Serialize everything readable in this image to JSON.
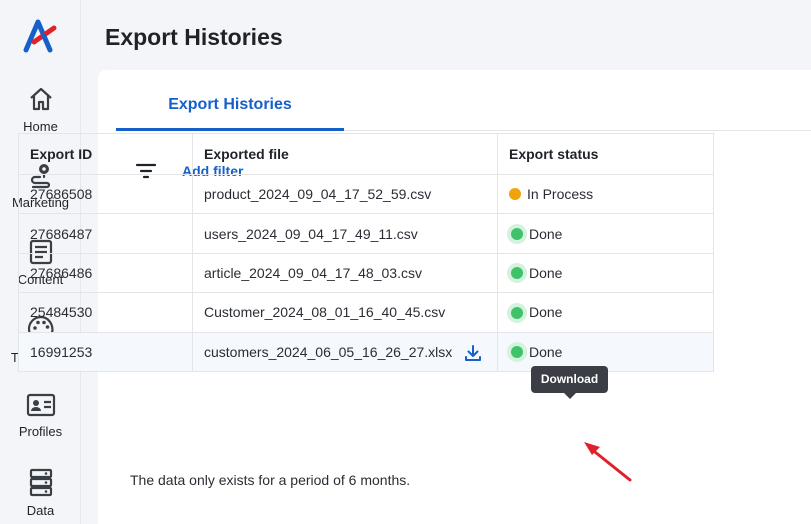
{
  "colors": {
    "accent": "#1560c9",
    "in_process": "#f0a30a",
    "done": "#3fc26a",
    "arrow": "#e0202a"
  },
  "sidebar": {
    "items": [
      {
        "label": "Home",
        "icon": "home-icon"
      },
      {
        "label": "Marketing",
        "icon": "marketing-icon"
      },
      {
        "label": "Content",
        "icon": "content-icon"
      },
      {
        "label": "Templates",
        "icon": "palette-icon"
      },
      {
        "label": "Profiles",
        "icon": "profile-card-icon"
      },
      {
        "label": "Data",
        "icon": "database-icon"
      }
    ]
  },
  "header": {
    "title": "Export Histories"
  },
  "tabs": [
    {
      "label": "Export Histories",
      "active": true
    }
  ],
  "filter": {
    "label": "Add filter",
    "icon": "filter-icon"
  },
  "table": {
    "columns": [
      "Export ID",
      "Exported file",
      "Export status"
    ],
    "rows": [
      {
        "id": "27686508",
        "file": "product_2024_09_04_17_52_59.csv",
        "status": "In Process"
      },
      {
        "id": "27686487",
        "file": "users_2024_09_04_17_49_11.csv",
        "status": "Done"
      },
      {
        "id": "27686486",
        "file": "article_2024_09_04_17_48_03.csv",
        "status": "Done"
      },
      {
        "id": "25484530",
        "file": "Customer_2024_08_01_16_40_45.csv",
        "status": "Done"
      },
      {
        "id": "16991253",
        "file": "customers_2024_06_05_16_26_27.xlsx",
        "status": "Done"
      }
    ]
  },
  "tooltip": {
    "label": "Download"
  },
  "note": "The data only exists for a period of 6 months."
}
